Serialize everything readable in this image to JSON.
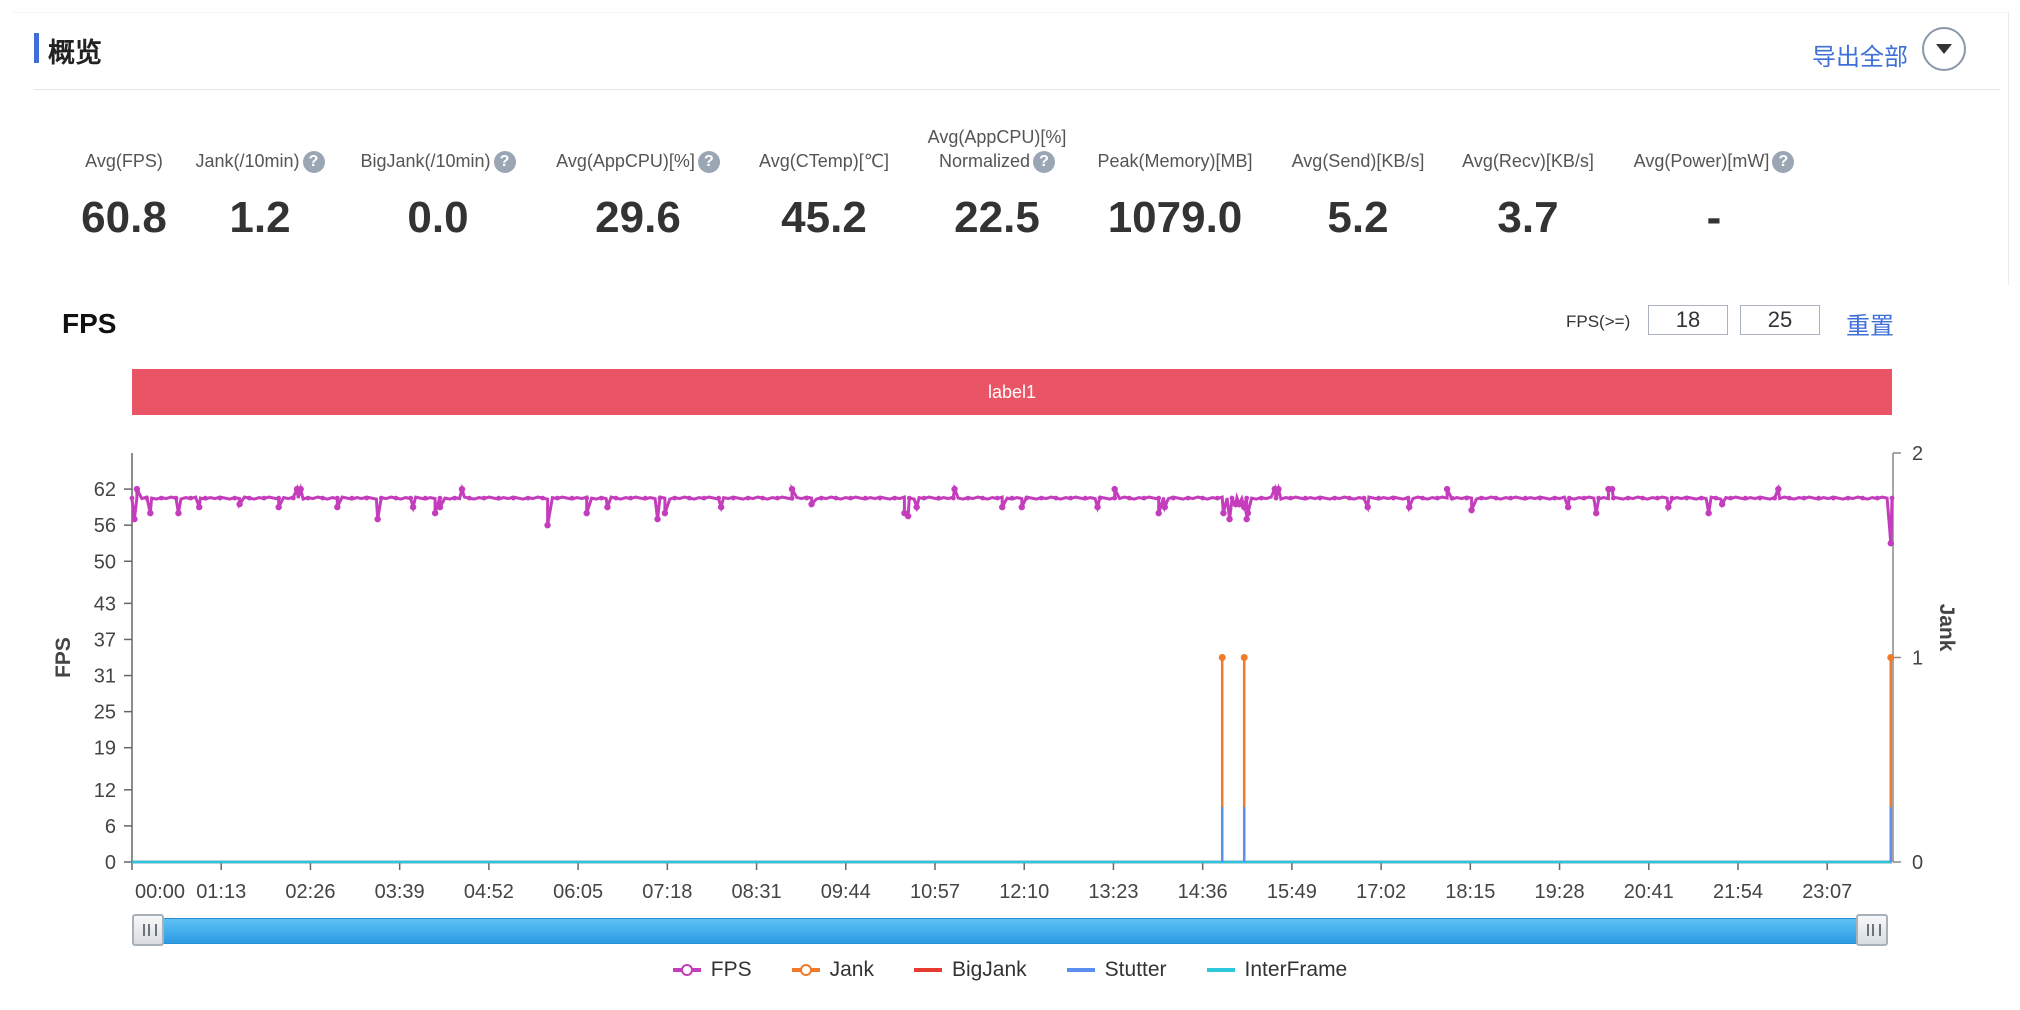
{
  "overview": {
    "title": "概览",
    "export_all": "导出全部",
    "help_glyph": "?",
    "metrics": [
      {
        "label": "Avg(FPS)",
        "value": "60.8",
        "help": false
      },
      {
        "label": "Jank(/10min)",
        "value": "1.2",
        "help": true
      },
      {
        "label": "BigJank(/10min)",
        "value": "0.0",
        "help": true
      },
      {
        "label": "Avg(AppCPU)[%]",
        "value": "29.6",
        "help": true
      },
      {
        "label": "Avg(CTemp)[℃]",
        "value": "45.2",
        "help": false
      },
      {
        "label": "Avg(AppCPU)[%]",
        "label2": "Normalized",
        "value": "22.5",
        "help": true
      },
      {
        "label": "Peak(Memory)[MB]",
        "value": "1079.0",
        "help": false
      },
      {
        "label": "Avg(Send)[KB/s]",
        "value": "5.2",
        "help": false
      },
      {
        "label": "Avg(Recv)[KB/s]",
        "value": "3.7",
        "help": false
      },
      {
        "label": "Avg(Power)[mW]",
        "value": "-",
        "help": true
      }
    ]
  },
  "fps_panel": {
    "title": "FPS",
    "threshold_label": "FPS(>=)",
    "threshold_low": "18",
    "threshold_high": "25",
    "reset": "重置",
    "label_band": "label1"
  },
  "chart_data": {
    "type": "line",
    "x_labels": [
      "00:00",
      "01:13",
      "02:26",
      "03:39",
      "04:52",
      "06:05",
      "07:18",
      "08:31",
      "09:44",
      "10:57",
      "12:10",
      "13:23",
      "14:36",
      "15:49",
      "17:02",
      "18:15",
      "19:28",
      "20:41",
      "21:54",
      "23:07"
    ],
    "x_range_minutes": [
      0,
      1440
    ],
    "ylabel": "FPS",
    "ylabel_right": "Jank",
    "y_ticks": [
      0,
      6,
      12,
      19,
      25,
      31,
      37,
      43,
      50,
      56,
      62
    ],
    "ylim": [
      0,
      68
    ],
    "y2_ticks": [
      0,
      1,
      2
    ],
    "y2lim": [
      0,
      2
    ],
    "grid": false,
    "legend_position": "bottom",
    "series": [
      {
        "name": "FPS",
        "color": "#c43dbd",
        "axis": "left",
        "baseline": 60.5,
        "dips": [
          [
            2,
            57
          ],
          [
            15,
            58
          ],
          [
            38,
            58
          ],
          [
            55,
            59
          ],
          [
            88,
            59.5
          ],
          [
            120,
            59
          ],
          [
            135,
            58.5
          ],
          [
            168,
            59
          ],
          [
            201,
            57
          ],
          [
            230,
            59
          ],
          [
            248,
            58
          ],
          [
            252,
            59
          ],
          [
            340,
            56
          ],
          [
            372,
            58
          ],
          [
            389,
            59
          ],
          [
            436,
            58
          ],
          [
            430,
            57
          ],
          [
            482,
            59
          ],
          [
            556,
            59.5
          ],
          [
            632,
            58
          ],
          [
            635,
            57.5
          ],
          [
            642,
            59
          ],
          [
            712,
            59
          ],
          [
            728,
            59
          ],
          [
            790,
            59
          ],
          [
            840,
            58
          ],
          [
            845,
            59
          ],
          [
            893,
            58
          ],
          [
            898,
            57
          ],
          [
            903,
            59.5
          ],
          [
            906,
            59.5
          ],
          [
            910,
            59
          ],
          [
            913,
            58
          ],
          [
            912,
            57
          ],
          [
            1011,
            59
          ],
          [
            1045,
            59
          ],
          [
            1096,
            58.5
          ],
          [
            1175,
            59
          ],
          [
            1198,
            58
          ],
          [
            1257,
            59
          ],
          [
            1290,
            58
          ],
          [
            1301,
            59.5
          ],
          [
            1439,
            53
          ]
        ],
        "peaks": [
          [
            4,
            62
          ],
          [
            135,
            62
          ],
          [
            138,
            62
          ],
          [
            270,
            62
          ],
          [
            540,
            62
          ],
          [
            673,
            62
          ],
          [
            804,
            62
          ],
          [
            935,
            62
          ],
          [
            938,
            62
          ],
          [
            1076,
            62
          ],
          [
            1208,
            62
          ],
          [
            1211,
            62
          ],
          [
            1347,
            62
          ]
        ]
      },
      {
        "name": "Jank",
        "color": "#f07a2b",
        "axis": "right",
        "baseline": 0,
        "spikes": [
          [
            892,
            1
          ],
          [
            910,
            1
          ],
          [
            1439,
            1
          ]
        ]
      },
      {
        "name": "BigJank",
        "color": "#e63b2e",
        "axis": "right",
        "baseline": 0,
        "spikes": []
      },
      {
        "name": "Stutter",
        "color": "#5b8ff0",
        "axis": "right",
        "baseline": 0,
        "spikes": [
          [
            892,
            0.27
          ],
          [
            910,
            0.27
          ],
          [
            1439,
            0.27
          ]
        ]
      },
      {
        "name": "InterFrame",
        "color": "#2ec7d9",
        "axis": "right",
        "baseline": 0,
        "spikes": []
      }
    ]
  }
}
